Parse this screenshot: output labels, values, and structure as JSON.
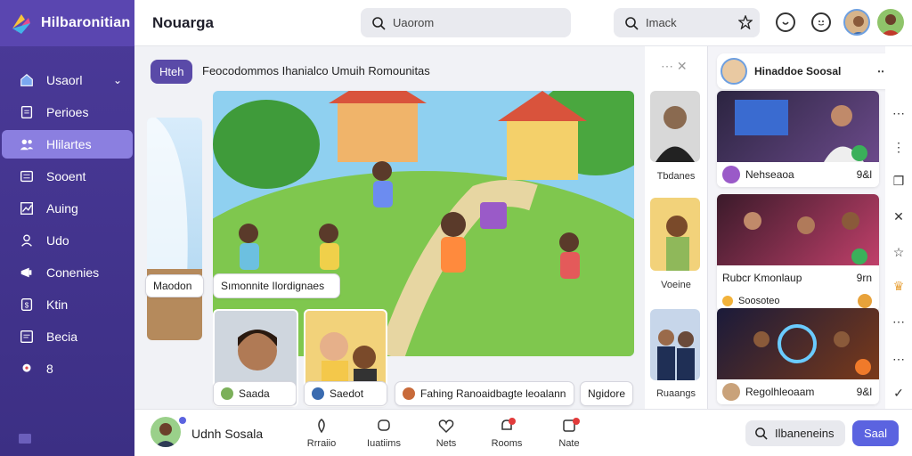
{
  "app": {
    "name": "Hilbaronitian"
  },
  "sidebar": {
    "items": [
      {
        "label": "Usaorl",
        "icon": "home-icon"
      },
      {
        "label": "Perioes",
        "icon": "document-icon"
      },
      {
        "label": "Hlilartes",
        "icon": "people-icon"
      },
      {
        "label": "Sooent",
        "icon": "list-icon"
      },
      {
        "label": "Auing",
        "icon": "chart-icon"
      },
      {
        "label": "Udo",
        "icon": "user-icon"
      },
      {
        "label": "Conenies",
        "icon": "megaphone-icon"
      },
      {
        "label": "Ktin",
        "icon": "share-icon"
      },
      {
        "label": "Becia",
        "icon": "book-icon"
      },
      {
        "label": "8",
        "icon": "pin-icon"
      }
    ]
  },
  "header": {
    "title": "Nouarga",
    "search_placeholder": "Uaorom",
    "search2_placeholder": "Imack"
  },
  "main": {
    "chip": "Hteh",
    "headline": "Feocodommos Ihanialco Umuih Romounitas",
    "left_label": "Maodon",
    "hero_label": "Sımonnite Ilordignaes",
    "thumbs": [
      {
        "label": "Saada"
      },
      {
        "label": "Saedot"
      },
      {
        "label": "Fahing Ranoaidbagte leoalann"
      },
      {
        "label": "Ngidore"
      }
    ]
  },
  "midcol": {
    "items": [
      "Tbdanes",
      "Voeine",
      "Ruaangs"
    ]
  },
  "right": {
    "header": "Hinaddoe Soosal",
    "cards": [
      {
        "title": "Nehseaoa",
        "meta": "9&l",
        "badge": "9&l"
      },
      {
        "title": "Rubcr Kmonlaup",
        "meta": "9rn",
        "sub": "Soosoteo"
      },
      {
        "title": "Regolhleoaam",
        "meta": "9&l"
      }
    ]
  },
  "bottom": {
    "user": "Udnh Sosala",
    "items": [
      "Rrraiio",
      "Iuatiims",
      "Nets",
      "Rooms",
      "Nate"
    ],
    "search_placeholder": "Ilbaneneins",
    "button": "Saal"
  },
  "colors": {
    "brand": "#4b3a99",
    "accent": "#5b63e0",
    "active": "#8b7fe0"
  }
}
